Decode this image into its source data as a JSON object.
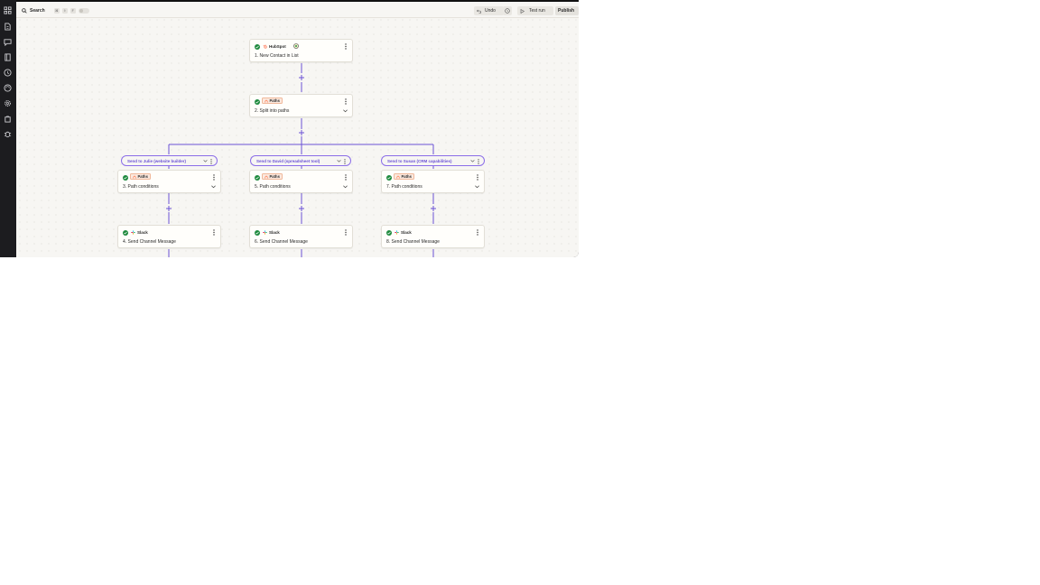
{
  "topbar": {
    "search_label": "Search",
    "shortcut_keys": [
      "⌘",
      "⇧",
      "F"
    ],
    "undo_label": "Undo",
    "test_run_label": "Test run",
    "publish_label": "Publish"
  },
  "sidebar": {
    "icons": [
      "apps-icon",
      "document-icon",
      "chat-icon",
      "notes-icon",
      "history-icon",
      "versions-icon",
      "settings-icon",
      "bag-icon",
      "bug-icon"
    ]
  },
  "trigger": {
    "app": "HubSpot",
    "step": "1. New Contact in List"
  },
  "split": {
    "app": "Paths",
    "step": "2. Split into paths"
  },
  "paths": [
    {
      "label": "Send to Julie (website builder)",
      "condition": {
        "app": "Paths",
        "step": "3. Path conditions"
      },
      "action": {
        "app": "Slack",
        "step": "4. Send Channel Message"
      }
    },
    {
      "label": "Send to David (spreadsheet tool)",
      "condition": {
        "app": "Paths",
        "step": "5. Path conditions"
      },
      "action": {
        "app": "Slack",
        "step": "6. Send Channel Message"
      }
    },
    {
      "label": "Send to Susan (CRM capabilities)",
      "condition": {
        "app": "Paths",
        "step": "7. Path conditions"
      },
      "action": {
        "app": "Slack",
        "step": "8. Send Channel Message"
      }
    }
  ],
  "colors": {
    "connector": "#6b52d6",
    "success": "#1e8a3e",
    "hubspot": "#ff7a59",
    "paths_badge": "#fbe9df"
  }
}
